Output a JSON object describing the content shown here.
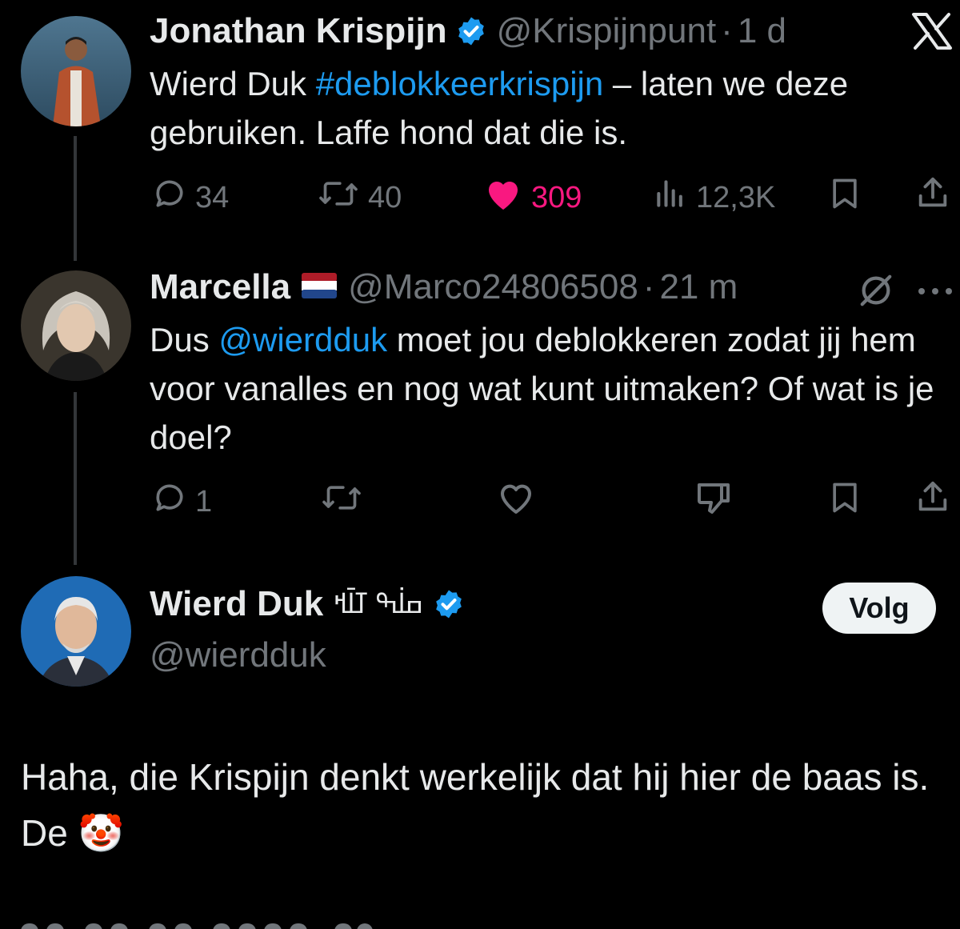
{
  "colors": {
    "background": "#000000",
    "text": "#e7e9ea",
    "muted": "#71767b",
    "link": "#1d9bf0",
    "like_active": "#f91880",
    "verified": "#1d9bf0"
  },
  "tweet1": {
    "name": "Jonathan Krispijn",
    "handle": "@Krispijnpunt",
    "sep": "·",
    "time": "1 d",
    "text_prefix": "Wierd Duk ",
    "hashtag": "#deblokkeerkrispijn",
    "text_suffix": " – laten we deze gebruiken. Laffe hond dat die is.",
    "replies": "34",
    "retweets": "40",
    "likes": "309",
    "views": "12,3K",
    "platform_icon": "x-logo-icon",
    "liked": true
  },
  "tweet2": {
    "name": "Marcella",
    "flag": "flag-netherlands-icon",
    "handle": "@Marco24806508",
    "sep": "·",
    "time": "21 m",
    "text_prefix": "Dus ",
    "mention": "@wierdduk",
    "text_suffix": " moet jou deblokkeren zodat jij hem voor vanalles en nog wat kunt uitmaken? Of wat is je doel?",
    "replies": "1"
  },
  "tweet3": {
    "name": "Wierd Duk",
    "name_suffix": "ߛߊ߭ߒ ߠߊ߫ߞ",
    "handle": "@wierdduk",
    "follow_label": "Volg",
    "text": "Haha, die Krispijn denkt werkelijk dat hij hier de baas is. De",
    "emoji": "🤡"
  }
}
